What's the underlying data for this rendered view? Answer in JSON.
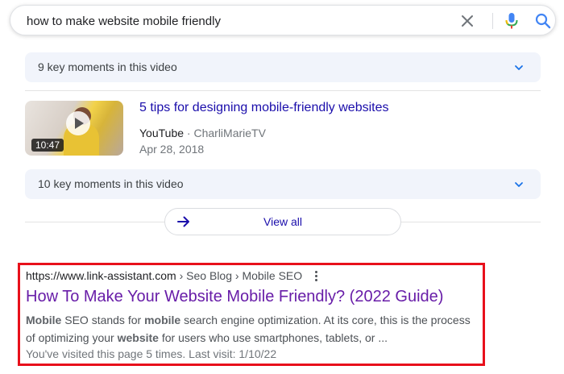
{
  "search": {
    "query": "how to make website mobile friendly"
  },
  "icons": {
    "clear": "close-icon",
    "mic": "microphone-icon",
    "search": "search-icon",
    "chevron": "chevron-down-icon",
    "arrow": "arrow-right-icon",
    "more": "more-vert-icon"
  },
  "colors": {
    "link_blue": "#1a0dab",
    "visited_purple": "#681da8",
    "highlight_red": "#e8101b",
    "key_moments_bg": "#f1f4fb",
    "search_blue": "#4285f4"
  },
  "key_moments_1": {
    "label": "9 key moments in this video"
  },
  "video": {
    "duration": "10:47",
    "title": "5 tips for designing mobile-friendly websites",
    "source": "YouTube",
    "separator": "·",
    "channel": "CharliMarieTV",
    "date": "Apr 28, 2018"
  },
  "key_moments_2": {
    "label": "10 key moments in this video"
  },
  "view_all": {
    "label": "View all"
  },
  "result": {
    "domain": "https://www.link-assistant.com",
    "breadcrumb": " › Seo Blog › Mobile SEO",
    "title": "How To Make Your Website Mobile Friendly? (2022 Guide)",
    "snippet": {
      "b1": "Mobile",
      "t1": " SEO stands for ",
      "b2": "mobile",
      "t2": " search engine optimization. At its core, this is the process of optimizing your ",
      "b3": "website",
      "t3": " for users who use smartphones, tablets, or ..."
    },
    "visited": "You've visited this page 5 times. Last visit: 1/10/22"
  }
}
